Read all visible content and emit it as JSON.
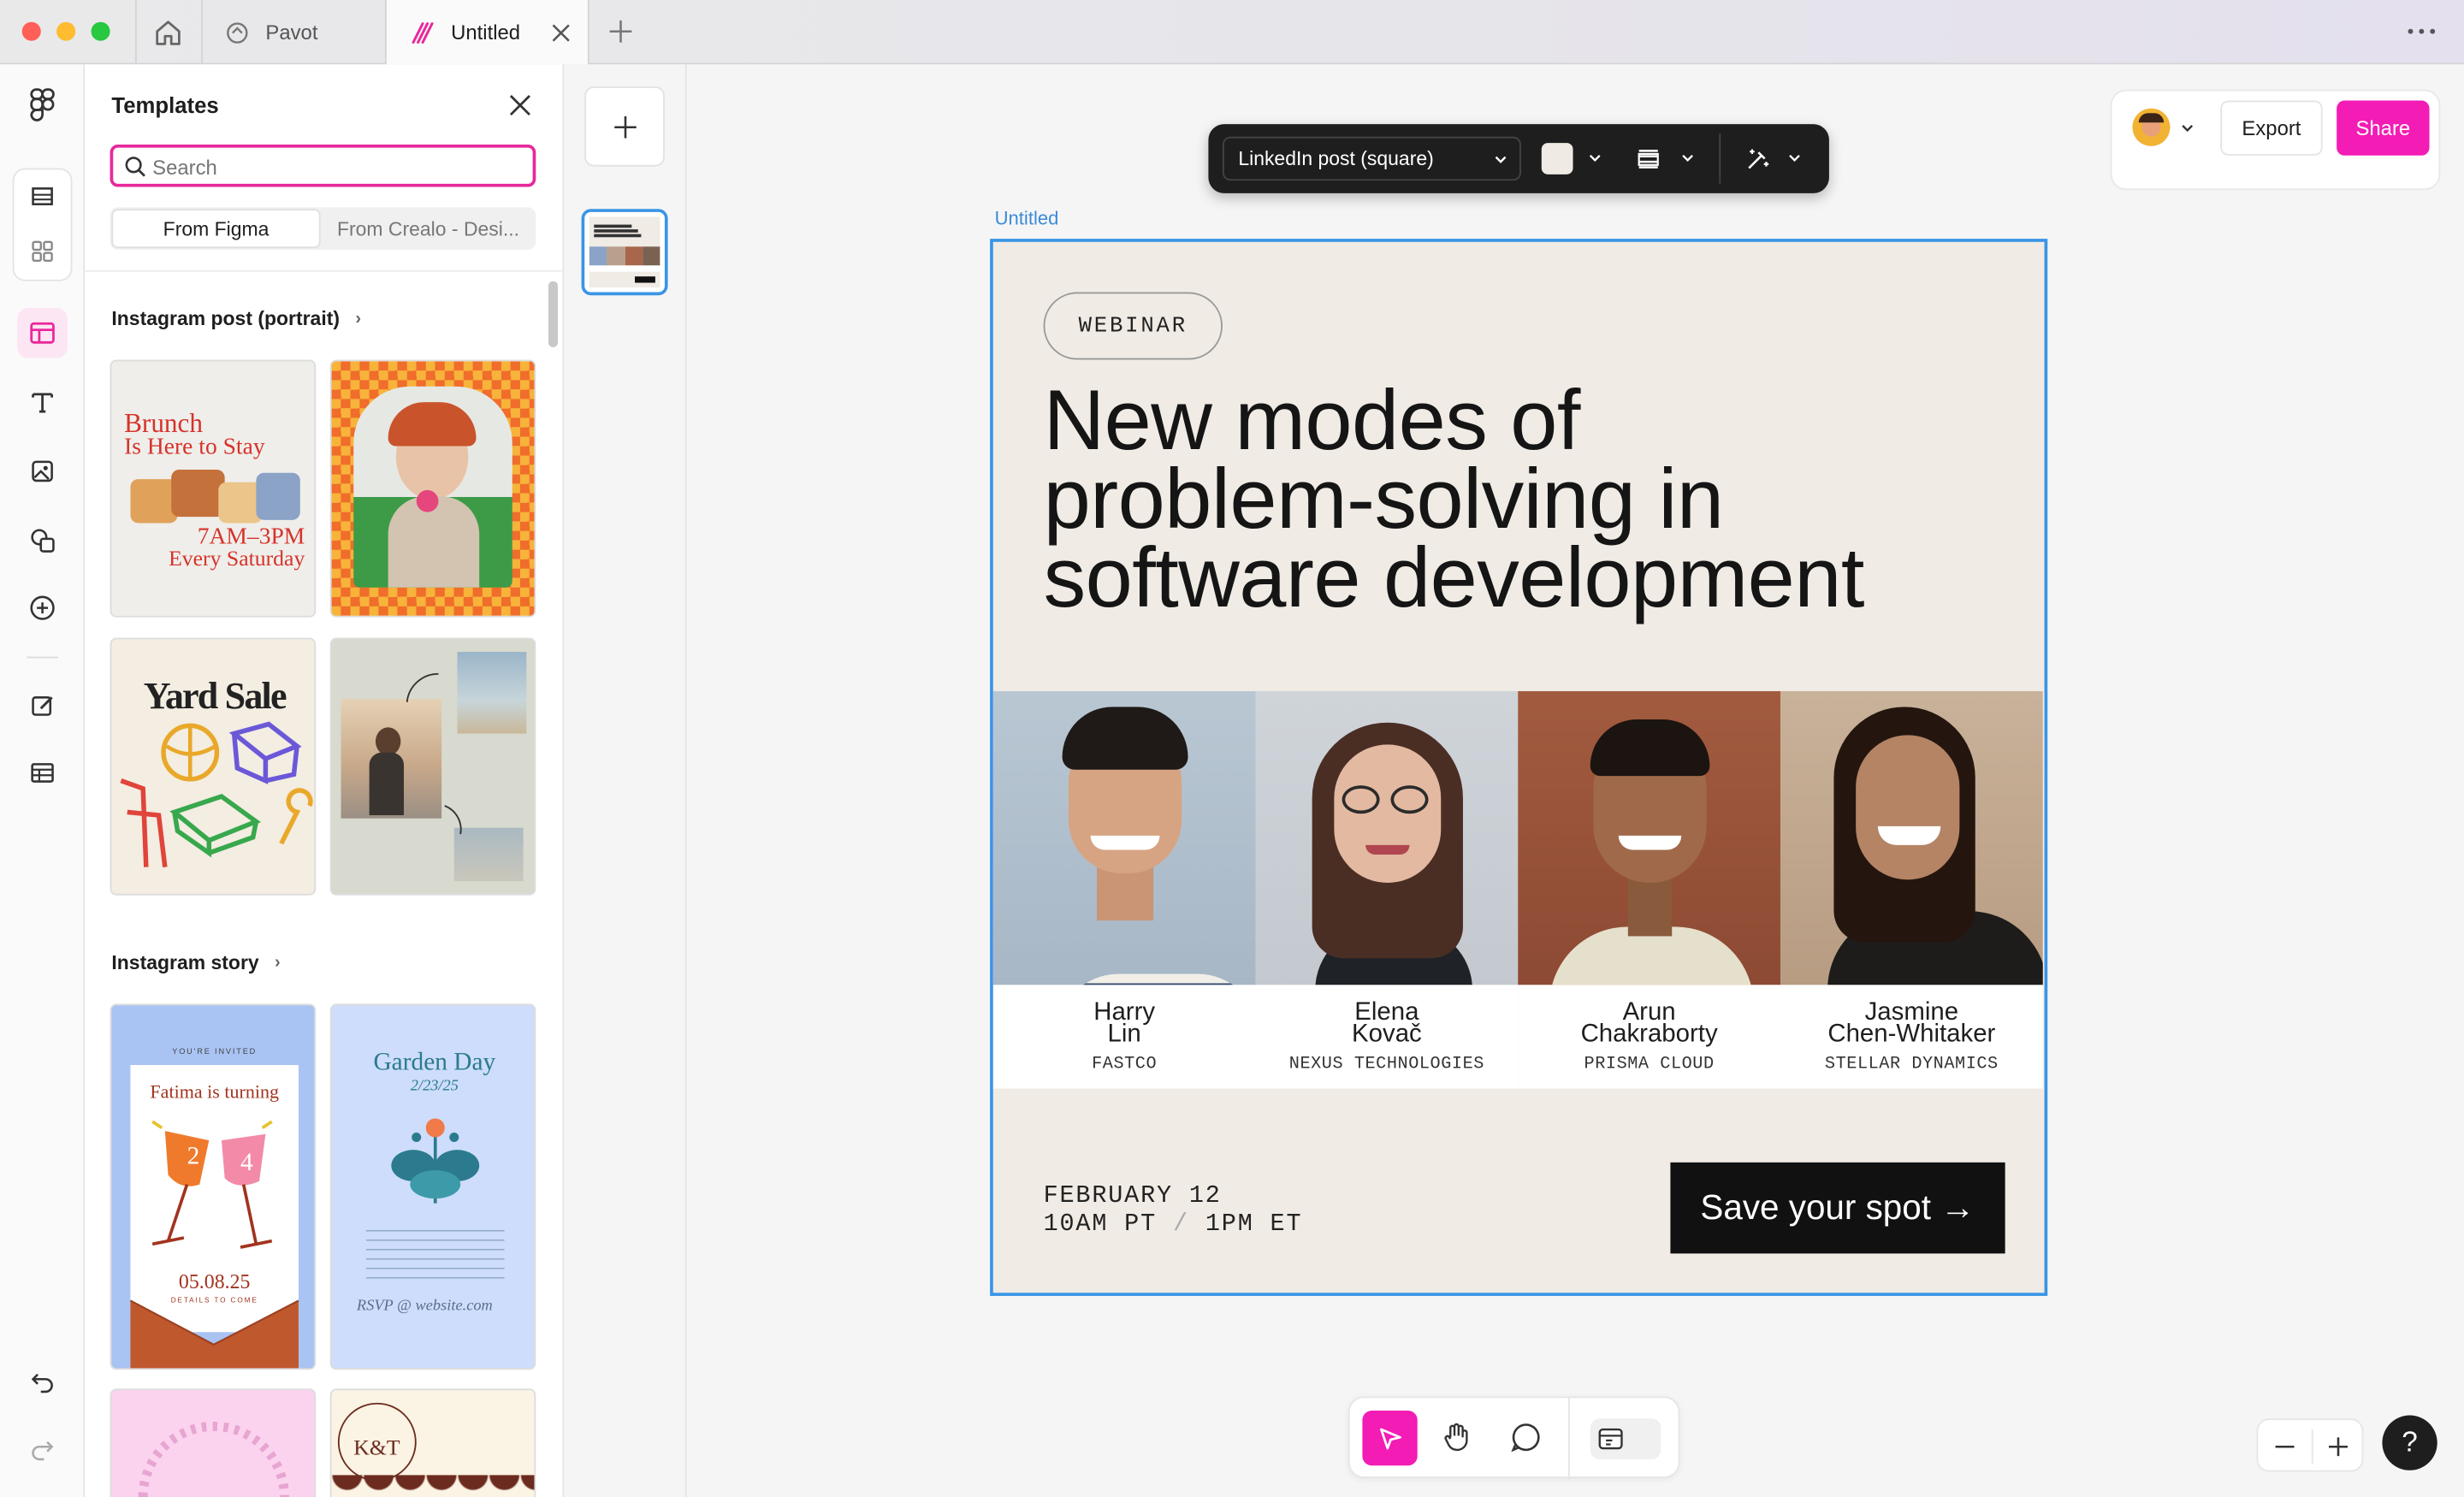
{
  "tabs": [
    {
      "label": "Pavot"
    },
    {
      "label": "Untitled"
    }
  ],
  "panel": {
    "title": "Templates",
    "search_placeholder": "Search",
    "segments": [
      "From Figma",
      "From Crealo - Desi..."
    ],
    "section1": {
      "title": "Instagram post (portrait)",
      "thumb1": {
        "line1": "Brunch",
        "line2": "Is Here to Stay",
        "line3": "7AM–3PM",
        "line4": "Every Saturday"
      },
      "thumb3": {
        "title": "Yard Sale"
      }
    },
    "section2": {
      "title": "Instagram story",
      "thumb1": {
        "top": "YOU'RE INVITED",
        "line": "Fatima is turning",
        "n1": "2",
        "n2": "4",
        "date": "05.08.25",
        "sub": "DETAILS TO COME"
      },
      "thumb2": {
        "title": "Garden Day",
        "date": "2/23/25",
        "sig": "RSVP @ website.com"
      }
    }
  },
  "toolbar": {
    "format_label": "LinkedIn post (square)",
    "fill_color": "#efebe4"
  },
  "topright": {
    "export_label": "Export",
    "share_label": "Share"
  },
  "frame": {
    "label": "Untitled",
    "badge": "WEBINAR",
    "headline_l1": "New modes of",
    "headline_l2": "problem-solving in",
    "headline_l3": "software development",
    "speakers": [
      {
        "first": "Harry",
        "last": "Lin",
        "company": "FASTCO"
      },
      {
        "first": "Elena",
        "last": "Kovač",
        "company": "NEXUS TECHNOLOGIES"
      },
      {
        "first": "Arun",
        "last": "Chakraborty",
        "company": "PRISMA CLOUD"
      },
      {
        "first": "Jasmine",
        "last": "Chen-Whitaker",
        "company": "STELLAR DYNAMICS"
      }
    ],
    "date_line": "FEBRUARY 12",
    "time_pt": "10AM PT",
    "time_sep": "/",
    "time_et": "1PM ET",
    "cta": "Save your spot →"
  },
  "colors": {
    "accent": "#f31cb5",
    "selection": "#3a95e6",
    "frame_bg": "#f0ebe4"
  },
  "icons": [
    "home-icon",
    "figma-icon",
    "close-icon",
    "plus-icon",
    "more-icon",
    "search-icon",
    "text-icon",
    "image-icon",
    "shapes-icon",
    "plus-circle-icon",
    "edit-icon",
    "table-icon",
    "undo-icon",
    "redo-icon",
    "cursor-icon",
    "hand-icon",
    "comment-icon",
    "devmode-icon",
    "help-icon",
    "zoom-out-icon",
    "zoom-in-icon"
  ]
}
